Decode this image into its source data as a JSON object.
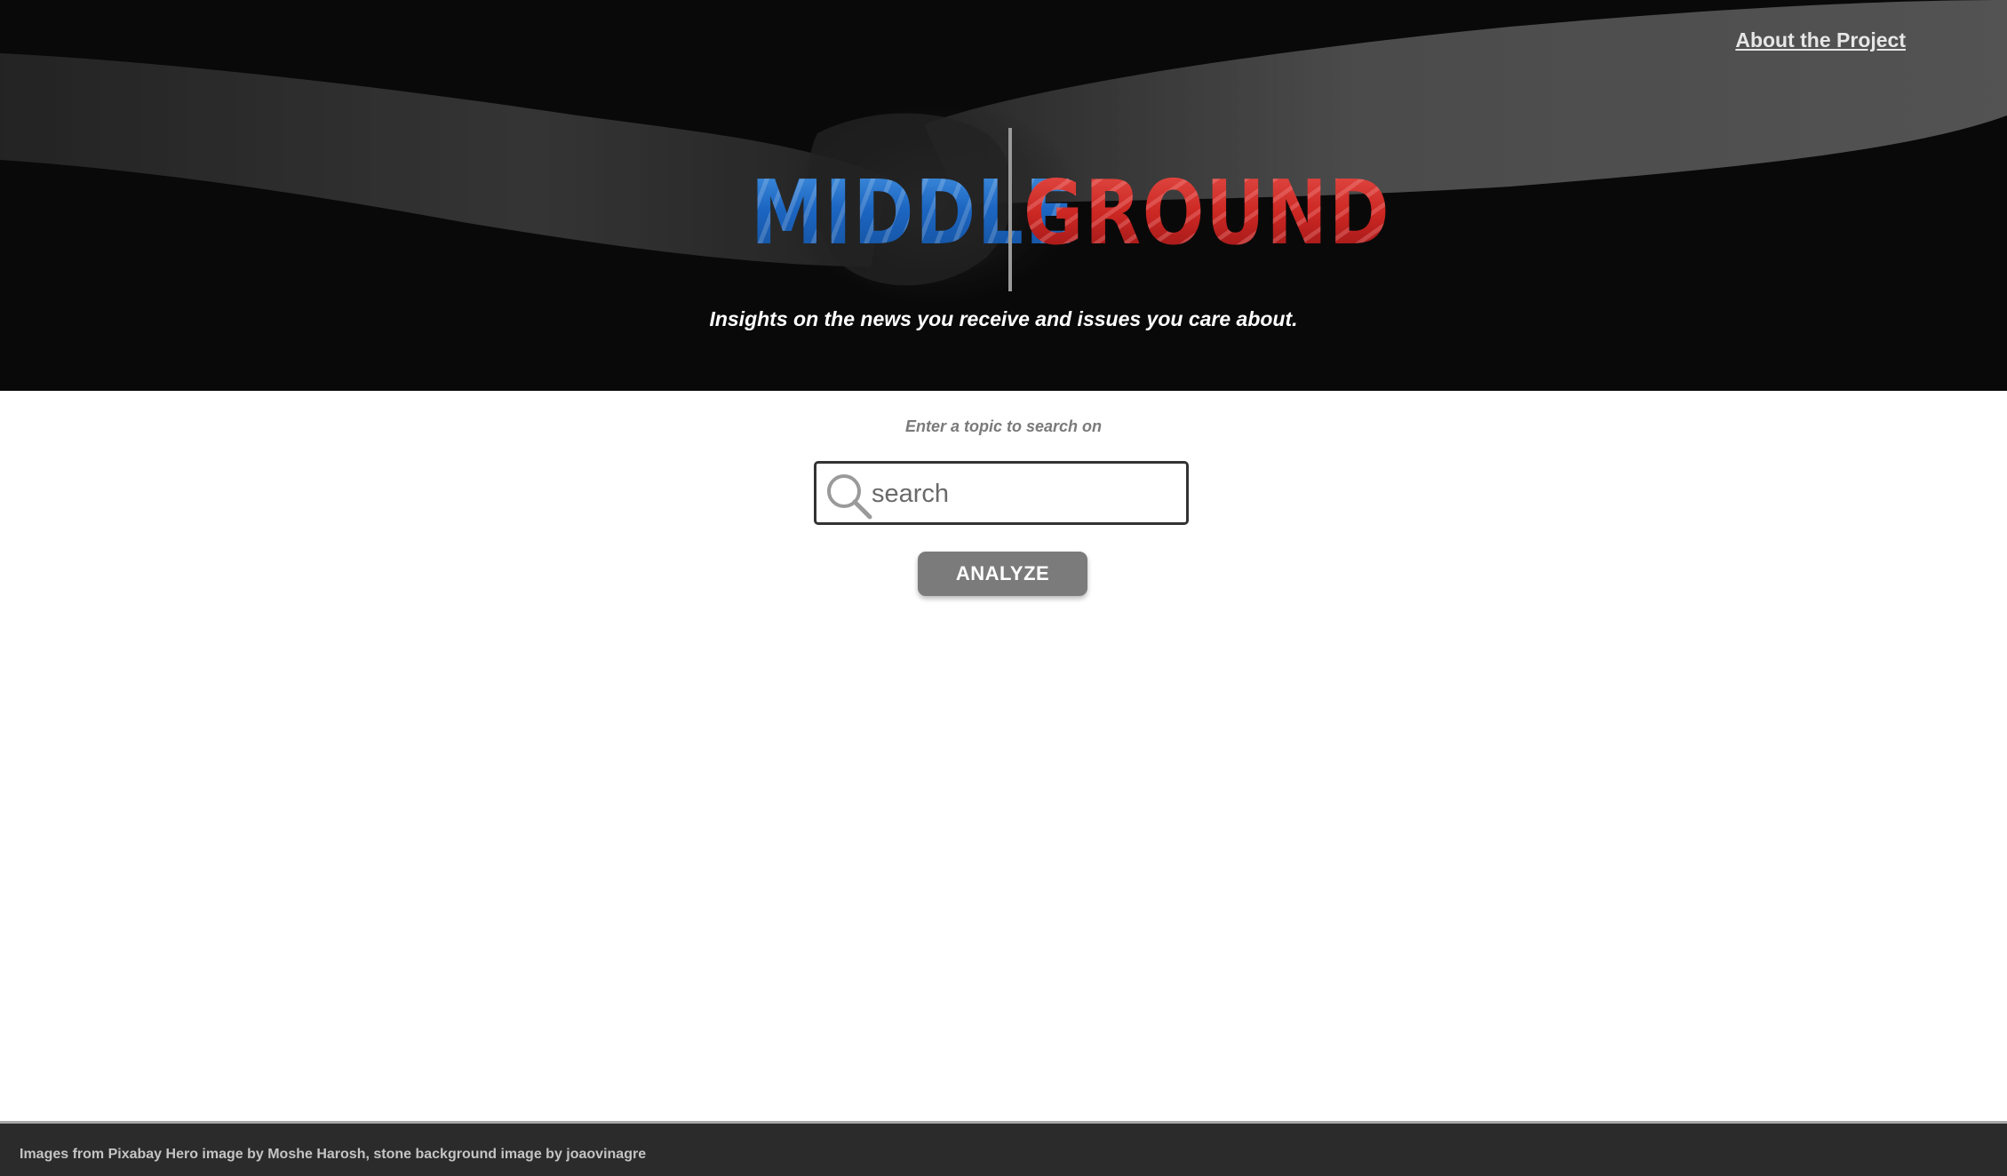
{
  "nav": {
    "about_label": "About the Project"
  },
  "logo": {
    "left_word": "MIDDLE",
    "right_word": "GROUND",
    "left_color": "#1c66c2",
    "right_color": "#cc2723"
  },
  "hero": {
    "tagline": "Insights on the news you receive and issues you care about."
  },
  "search": {
    "prompt": "Enter a topic to search on",
    "placeholder": "search",
    "value": "",
    "icon": "search-icon"
  },
  "actions": {
    "analyze_label": "ANALYZE"
  },
  "footer": {
    "credits": "Images from Pixabay Hero image by Moshe Harosh, stone background image by joaovinagre"
  },
  "colors": {
    "hero_background": "#0c0c0c",
    "button": "#7b7b7b",
    "footer_background": "#2b2b2b"
  }
}
